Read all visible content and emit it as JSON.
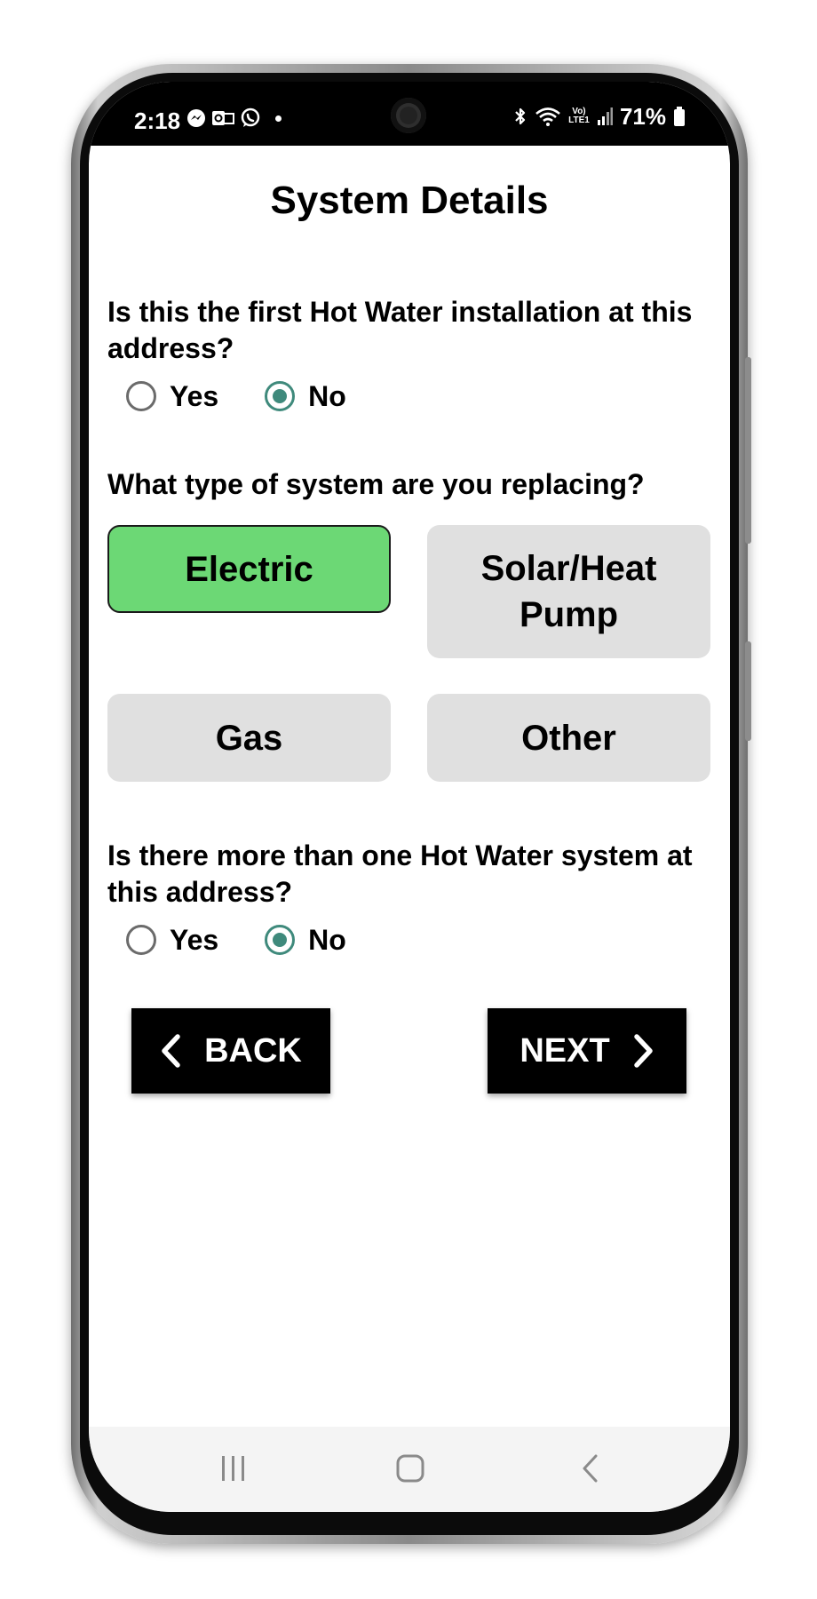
{
  "status_bar": {
    "time": "2:18",
    "battery_text": "71%",
    "volte_line1": "Vo)",
    "volte_line2": "LTE1",
    "icons_left": [
      "messenger-icon",
      "outlook-icon",
      "whatsapp-icon",
      "notification-dot"
    ],
    "icons_right": [
      "bluetooth-icon",
      "wifi-icon",
      "volte-icon",
      "signal-icon",
      "battery-icon"
    ]
  },
  "page": {
    "title": "System Details"
  },
  "question_first_install": {
    "text": "Is this the first Hot Water installation at this address?",
    "options": [
      "Yes",
      "No"
    ],
    "selected": "No"
  },
  "question_system_type": {
    "text": "What type of system are you replacing?",
    "options": {
      "electric": "Electric",
      "solar": "Solar/Heat Pump",
      "gas": "Gas",
      "other": "Other"
    },
    "selected": "Electric"
  },
  "question_multiple_systems": {
    "text": "Is there more than one Hot Water system at this address?",
    "options": [
      "Yes",
      "No"
    ],
    "selected": "No"
  },
  "navigation": {
    "back_label": "BACK",
    "next_label": "NEXT"
  },
  "colors": {
    "selected_button": "#6cd875",
    "unselected_button": "#e0e0e0",
    "radio_accent": "#3f8a7c",
    "nav_button": "#000000"
  }
}
